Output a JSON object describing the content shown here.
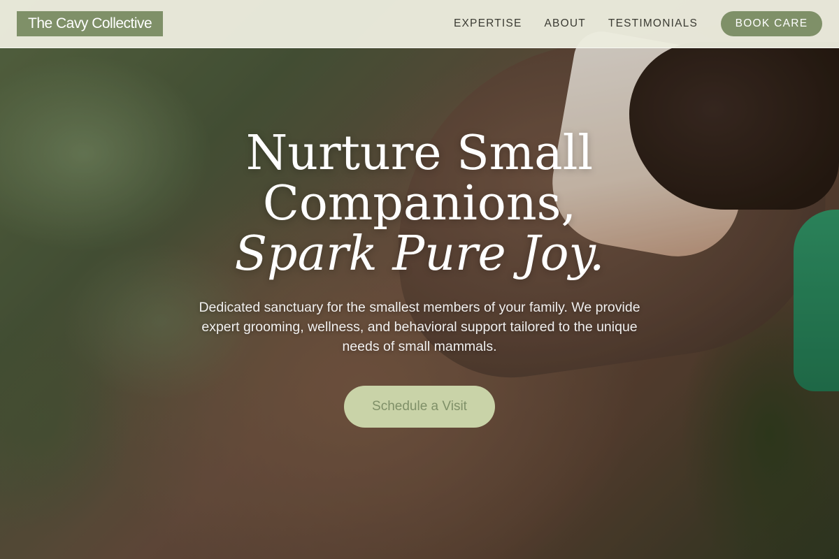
{
  "header": {
    "logo_text": "The Cavy Collective",
    "nav": [
      {
        "label": "EXPERTISE"
      },
      {
        "label": "ABOUT"
      },
      {
        "label": "TESTIMONIALS"
      }
    ],
    "cta_label": "BOOK CARE"
  },
  "hero": {
    "headline_line1": "Nurture Small",
    "headline_line2": "Companions,",
    "headline_line3": "Spark Pure Joy.",
    "subtext": "Dedicated sanctuary for the smallest members of your family. We provide expert grooming, wellness, and behavioral support tailored to the unique needs of small mammals.",
    "button_label": "Schedule a Visit"
  },
  "colors": {
    "brand_sage": "#7f9068",
    "button_light": "#c9d3a8",
    "header_bg": "#ecece0"
  }
}
